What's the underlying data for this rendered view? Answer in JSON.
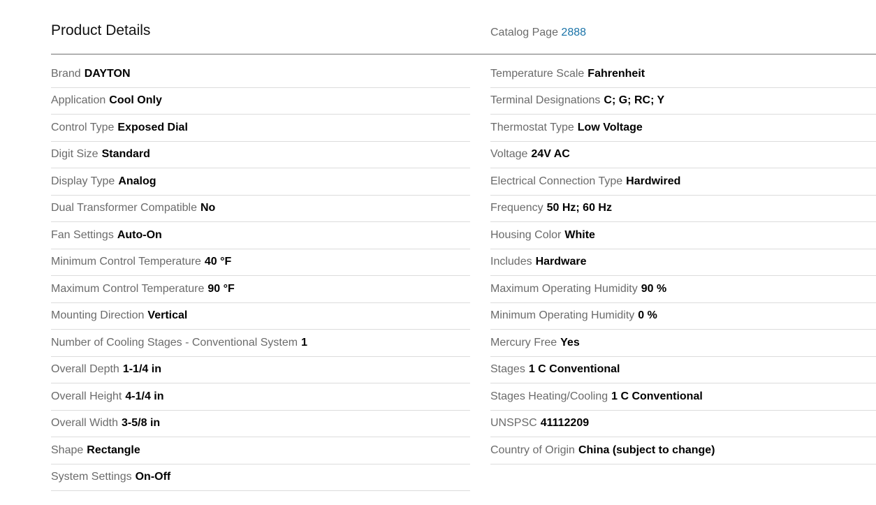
{
  "header": {
    "title": "Product Details",
    "catalog_label": "Catalog Page",
    "catalog_page": "2888"
  },
  "colors": {
    "label": "#6b6b6b",
    "value": "#000000",
    "link": "#1a73a8",
    "divider": "#dcdcdc"
  },
  "left_specs": [
    {
      "label": "Brand",
      "value": "DAYTON"
    },
    {
      "label": "Application",
      "value": "Cool Only"
    },
    {
      "label": "Control Type",
      "value": "Exposed Dial"
    },
    {
      "label": "Digit Size",
      "value": "Standard"
    },
    {
      "label": "Display Type",
      "value": "Analog"
    },
    {
      "label": "Dual Transformer Compatible",
      "value": "No"
    },
    {
      "label": "Fan Settings",
      "value": "Auto-On"
    },
    {
      "label": "Minimum Control Temperature",
      "value": "40 °F"
    },
    {
      "label": "Maximum Control Temperature",
      "value": "90 °F"
    },
    {
      "label": "Mounting Direction",
      "value": "Vertical"
    },
    {
      "label": "Number of Cooling Stages - Conventional System",
      "value": "1"
    },
    {
      "label": "Overall Depth",
      "value": "1-1/4 in"
    },
    {
      "label": "Overall Height",
      "value": "4-1/4 in"
    },
    {
      "label": "Overall Width",
      "value": "3-5/8 in"
    },
    {
      "label": "Shape",
      "value": "Rectangle"
    },
    {
      "label": "System Settings",
      "value": "On-Off"
    }
  ],
  "right_specs": [
    {
      "label": "Temperature Scale",
      "value": "Fahrenheit"
    },
    {
      "label": "Terminal Designations",
      "value": "C; G; RC; Y"
    },
    {
      "label": "Thermostat Type",
      "value": "Low Voltage"
    },
    {
      "label": "Voltage",
      "value": "24V AC"
    },
    {
      "label": "Electrical Connection Type",
      "value": "Hardwired"
    },
    {
      "label": "Frequency",
      "value": "50 Hz; 60 Hz"
    },
    {
      "label": "Housing Color",
      "value": "White"
    },
    {
      "label": "Includes",
      "value": "Hardware"
    },
    {
      "label": "Maximum Operating Humidity",
      "value": "90 %"
    },
    {
      "label": "Minimum Operating Humidity",
      "value": "0 %"
    },
    {
      "label": "Mercury Free",
      "value": "Yes"
    },
    {
      "label": "Stages",
      "value": "1 C Conventional"
    },
    {
      "label": "Stages Heating/Cooling",
      "value": "1 C Conventional"
    },
    {
      "label": "UNSPSC",
      "value": "41112209"
    },
    {
      "label": "Country of Origin",
      "value": "China (subject to change)"
    }
  ]
}
